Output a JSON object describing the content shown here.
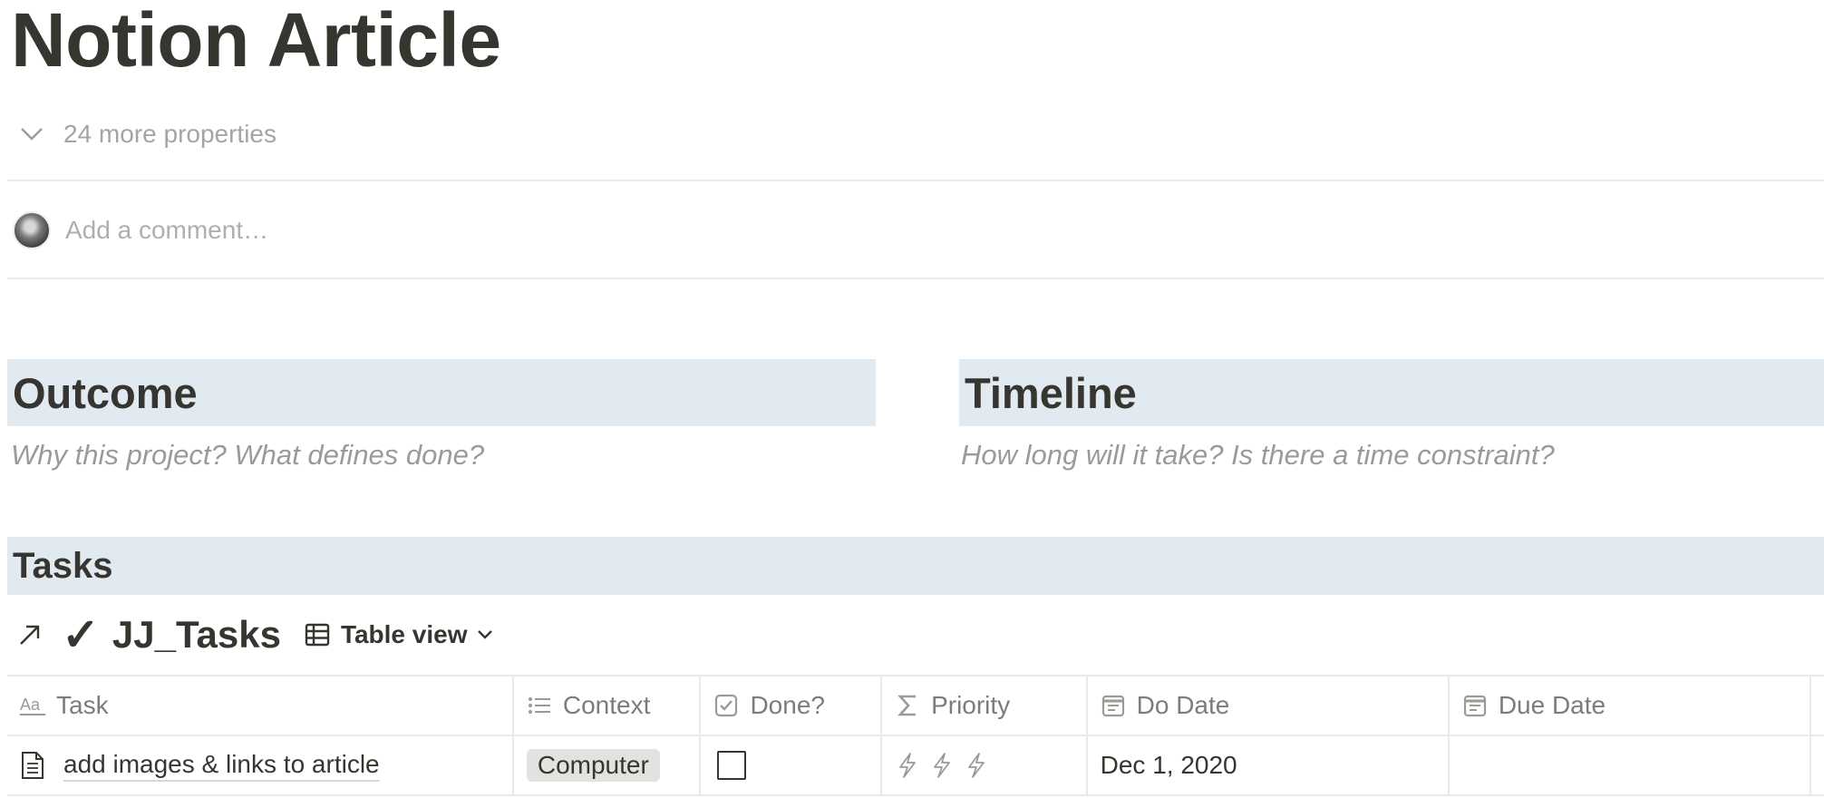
{
  "page": {
    "title": "Notion Article",
    "more_properties_label": "24 more properties",
    "comment_placeholder": "Add a comment…"
  },
  "sections": {
    "outcome": {
      "heading": "Outcome",
      "prompt": "Why this project?  What defines done?"
    },
    "timeline": {
      "heading": "Timeline",
      "prompt": "How long will it take?  Is there a time constraint?"
    },
    "tasks": {
      "heading": "Tasks"
    }
  },
  "database": {
    "check_glyph": "✓",
    "title": "JJ_Tasks",
    "view_label": "Table view",
    "columns": [
      {
        "label": "Task",
        "icon": "text-property-icon"
      },
      {
        "label": "Context",
        "icon": "list-property-icon"
      },
      {
        "label": "Done?",
        "icon": "checkbox-property-icon"
      },
      {
        "label": "Priority",
        "icon": "formula-sigma-icon"
      },
      {
        "label": "Do Date",
        "icon": "calendar-icon"
      },
      {
        "label": "Due Date",
        "icon": "calendar-icon"
      }
    ],
    "rows": [
      {
        "task": "add images & links to article",
        "context": "Computer",
        "done": false,
        "priority_bolts": 3,
        "do_date": "Dec 1, 2020",
        "due_date": ""
      }
    ]
  },
  "colors": {
    "text": "#37352f",
    "callout_bg": "#e1eaf1",
    "tag_bg": "#e3e2e0",
    "divider": "#e9e9e7"
  }
}
